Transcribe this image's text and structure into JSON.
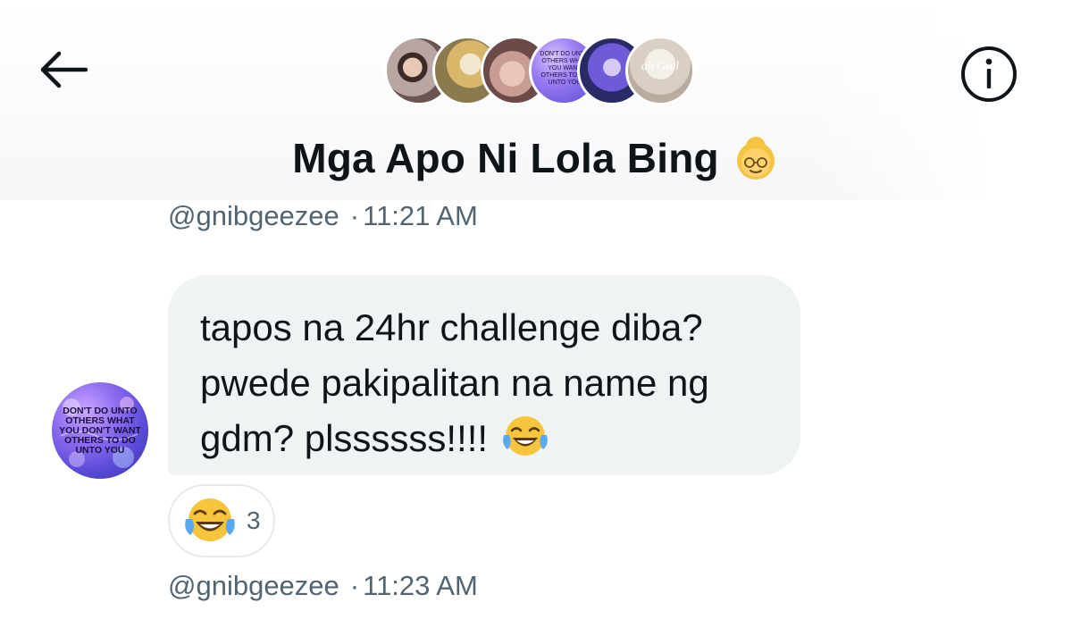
{
  "header": {
    "title": "Mga Apo Ni Lola Bing",
    "title_emoji": "older-woman-emoji",
    "back_icon": "arrow-left-icon",
    "info_icon": "info-circle-icon",
    "participant_avatars": [
      {
        "name": "participant-avatar-1"
      },
      {
        "name": "participant-avatar-2"
      },
      {
        "name": "participant-avatar-3"
      },
      {
        "name": "participant-avatar-4",
        "text": "DON'T DO UNTO OTHERS WHAT YOU WANT OTHERS TO DO UNTO YOU"
      },
      {
        "name": "participant-avatar-5"
      },
      {
        "name": "participant-avatar-6",
        "text": "ah Gail"
      }
    ]
  },
  "messages": [
    {
      "handle": "@gnibgeezee",
      "separator": "·",
      "time": "11:21 AM"
    },
    {
      "sender_avatar_text": "DON'T DO UNTO OTHERS WHAT YOU DON'T WANT OTHERS TO DO UNTO YOU",
      "text": "tapos na 24hr challenge diba?\npwede pakipalitan na name ng\ngdm? plssssss!!!!",
      "text_emoji": "face-with-tears-of-joy-emoji",
      "reaction": {
        "emoji": "face-with-tears-of-joy-emoji",
        "count": "3"
      },
      "handle": "@gnibgeezee",
      "separator": "·",
      "time": "11:23 AM"
    }
  ],
  "colors": {
    "bubble": "#eff3f4",
    "meta_text": "#536471",
    "primary_text": "#0f1419"
  }
}
